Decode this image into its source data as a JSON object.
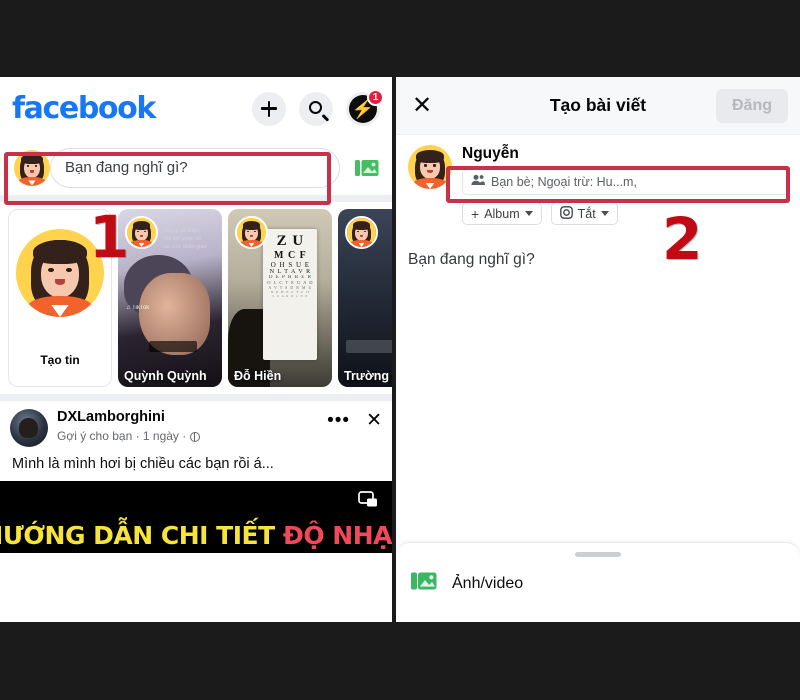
{
  "left_panel": {
    "app_name": "facebook",
    "header_icons": [
      {
        "name": "plus-icon",
        "label": "+"
      },
      {
        "name": "search-icon",
        "label": "search"
      },
      {
        "name": "messenger-icon",
        "label": "messenger",
        "badge": "1"
      }
    ],
    "composer": {
      "placeholder": "Bạn đang nghĩ gì?",
      "photo_icon": "photo-icon"
    },
    "stories": [
      {
        "type": "create",
        "label": "Tạo tin"
      },
      {
        "type": "story",
        "name": "Quỳnh Quỳnh",
        "overlay_text": "tian qi ao  Diệu\nhồi đết  yoan uế\nvà cuối khẩu giao vui!",
        "tag": "TikTok"
      },
      {
        "type": "story",
        "name": "Đỗ Hiền",
        "chart_lines": [
          "Z U",
          "M C F",
          "O H S U E",
          "N L T A V R",
          "D E P H B E R",
          "O L C T E U A D",
          "A V T S D R M U",
          "N P H E L T C O",
          "S U A R O L N E"
        ]
      },
      {
        "type": "story",
        "name": "Trường Lam"
      }
    ],
    "feed_post": {
      "author": "DXLamborghini",
      "subtitle": "Gợi ý cho bạn · 1 ngày ·",
      "body": "Mình là mình hơi bị chiều các bạn rồi á...",
      "more_icon": "more-options-icon",
      "close_icon": "close-icon",
      "media_banner_yellow": "HƯỚNG DẪN CHI TIẾT",
      "media_banner_red": "ĐỘ NHẠY",
      "pip_icon": "picture-in-picture-icon"
    }
  },
  "right_panel": {
    "header": {
      "close_icon": "close-icon",
      "title": "Tạo bài viết",
      "post_button": "Đăng"
    },
    "composer": {
      "user_name": "Nguyễn",
      "audience": "Bạn bè; Ngoại trừ: Hu...m,",
      "audience_icon": "friends-icon",
      "chips": [
        {
          "icon": "plus-icon",
          "label": "Album",
          "caret": "chevron-down-icon"
        },
        {
          "icon": "camera-icon",
          "label": "Tắt",
          "caret": "chevron-down-icon"
        }
      ],
      "placeholder": "Bạn đang nghĩ gì?"
    },
    "bottom_sheet": {
      "grip": "drag-handle",
      "item_icon": "photo-video-icon",
      "item_label": "Ảnh/video"
    }
  },
  "annotations": [
    {
      "number": "1"
    },
    {
      "number": "2"
    }
  ],
  "colors": {
    "facebook_blue": "#1877f2",
    "annotation_red": "#c00a14",
    "annotation_rect": "#c9314a",
    "badge_red": "#e41e3f",
    "media_yellow": "#f6e43c",
    "media_red": "#f2485b",
    "green_photo": "#45bd62",
    "backdrop": "#1b1b1b"
  }
}
